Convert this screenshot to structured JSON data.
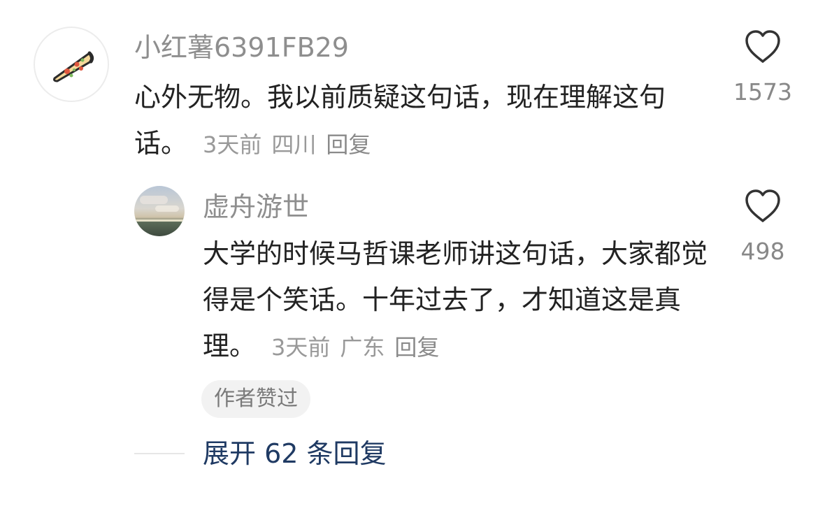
{
  "comment": {
    "username": "小红薯6391FB29",
    "content": "心外无物。我以前质疑这句话，现在理解这句话。",
    "time": "3天前",
    "location": "四川",
    "reply_label": "回复",
    "like_count": "1573",
    "avatar_icon": "pizza-slice-icon"
  },
  "reply": {
    "username": "虚舟游世",
    "content": "大学的时候马哲课老师讲这句话，大家都觉得是个笑话。十年过去了，才知道这是真理。",
    "time": "3天前",
    "location": "广东",
    "reply_label": "回复",
    "like_count": "498",
    "badge": "作者赞过",
    "avatar_icon": "landscape-photo-icon"
  },
  "expand_replies_label": "展开 62 条回复",
  "colors": {
    "username": "#8e8e8e",
    "content": "#222222",
    "meta": "#999999",
    "link": "#1f3a63",
    "badge_bg": "#f2f2f2"
  }
}
